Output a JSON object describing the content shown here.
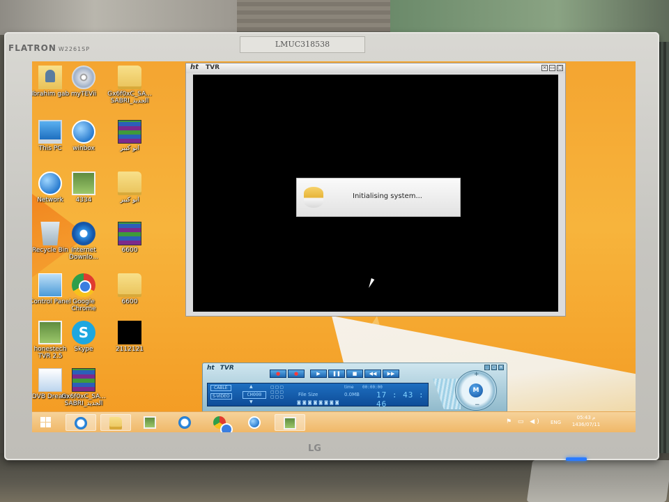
{
  "monitor": {
    "brand": "FLATRON",
    "model": "W2261SP",
    "serial_label": "LMUC318538",
    "logo": "LG"
  },
  "desktop_icons": [
    {
      "label": "Ibrahim gab",
      "icon": "user-folder-icon"
    },
    {
      "label": "myTEVii",
      "icon": "cd-icon"
    },
    {
      "label": "Gx6f0xC_SA...\nSABRI_الجديد",
      "icon": "folder-icon"
    },
    {
      "label": "This PC",
      "icon": "pc-icon"
    },
    {
      "label": "winbox",
      "icon": "winbox-icon"
    },
    {
      "label": "ابو كبير",
      "icon": "rar-icon"
    },
    {
      "label": "Network",
      "icon": "network-icon"
    },
    {
      "label": "4334",
      "icon": "image-icon"
    },
    {
      "label": "ابو كبير",
      "icon": "folder-icon"
    },
    {
      "label": "Recycle Bin",
      "icon": "recycle-bin-icon"
    },
    {
      "label": "Internet Downlo...",
      "icon": "idm-icon"
    },
    {
      "label": "6600",
      "icon": "rar-icon"
    },
    {
      "label": "Control Panel",
      "icon": "control-panel-icon"
    },
    {
      "label": "Google Chrome",
      "icon": "chrome-icon"
    },
    {
      "label": "6600",
      "icon": "folder-icon"
    },
    {
      "label": "honestech TVR 2.5",
      "icon": "tvr-icon"
    },
    {
      "label": "Skype",
      "icon": "skype-icon"
    },
    {
      "label": "2112121",
      "icon": "black-image-icon"
    },
    {
      "label": "DVB Dream",
      "icon": "dvb-icon"
    },
    {
      "label": "Gx6f0xC_SA...\nSABRI_الجديد",
      "icon": "rar-icon"
    }
  ],
  "tvr_window": {
    "logo": "ht",
    "title": "TVR",
    "dialog_text": "Initialising system..."
  },
  "tvr_panel": {
    "logo": "ht",
    "title": "TVR",
    "cable": "CABLE",
    "svideo": "S-VIDEO",
    "channel": "CH000",
    "file_size_label": "File Size",
    "file_size_value": "0.0MB",
    "time_label": "time",
    "time_value": "00:00:00",
    "clock": "17 : 43 : 46",
    "knob_label": "M",
    "knob_plus": "+",
    "knob_minus": "−"
  },
  "taskbar": {
    "items": [
      "start",
      "internet-explorer",
      "file-explorer",
      "photos",
      "idm",
      "chrome",
      "winbox",
      "tvr"
    ],
    "active_index": 7,
    "language": "ENG",
    "time": "05:43 م",
    "date": "1436/07/11"
  }
}
